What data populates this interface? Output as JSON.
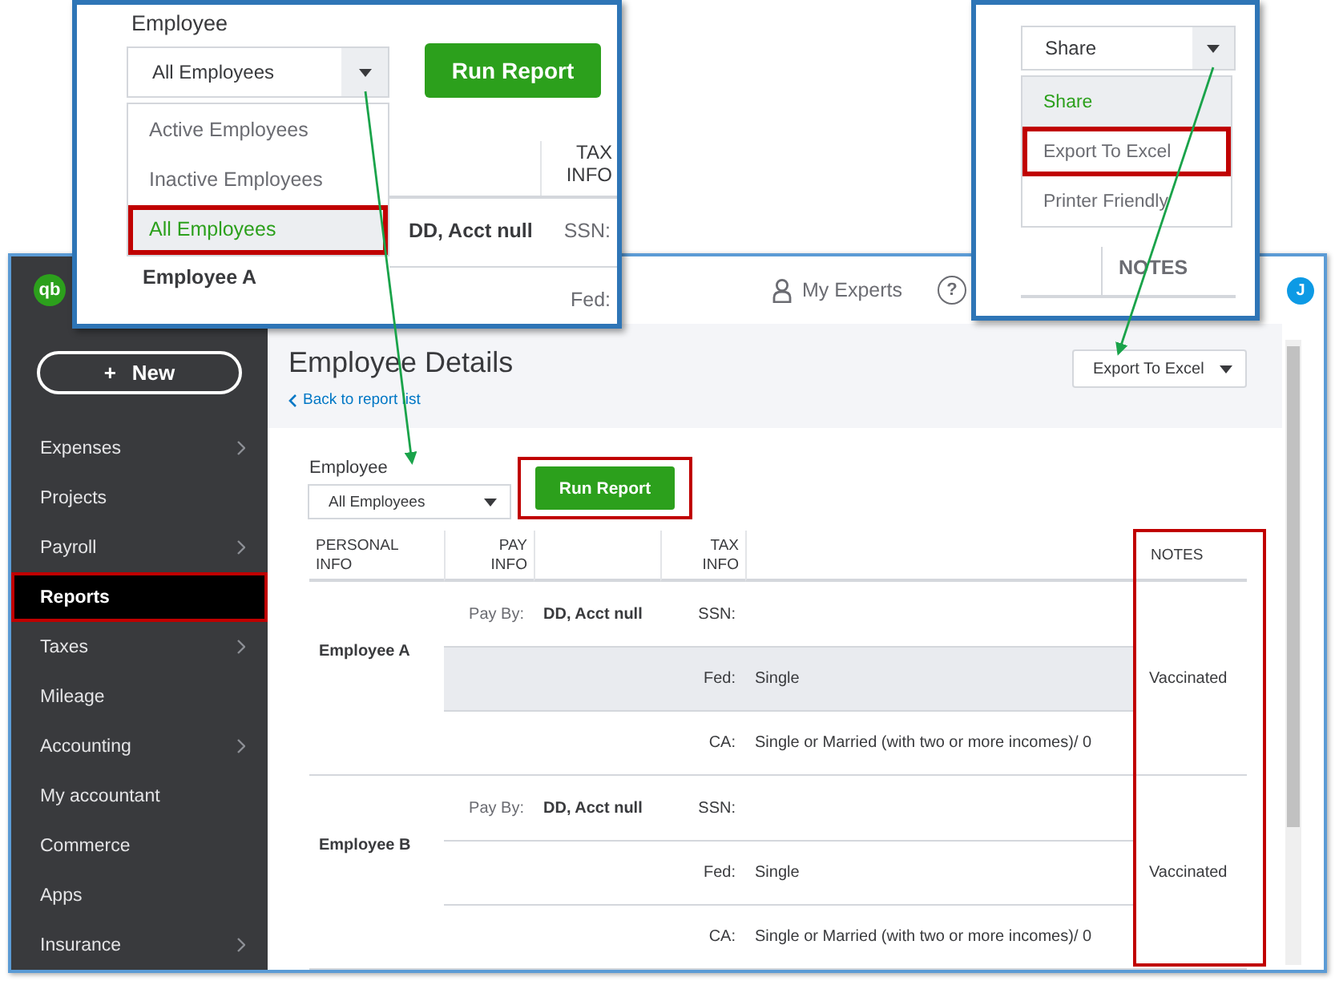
{
  "app": {
    "logo": "qb",
    "new_button": {
      "icon": "+",
      "label": "New"
    },
    "sidebar": {
      "items": [
        {
          "label": "Expenses",
          "arrow": true,
          "selected": false,
          "outlined": false
        },
        {
          "label": "Projects",
          "arrow": false,
          "selected": false,
          "outlined": false
        },
        {
          "label": "Payroll",
          "arrow": true,
          "selected": false,
          "outlined": false
        },
        {
          "label": "Reports",
          "arrow": false,
          "selected": true,
          "outlined": true
        },
        {
          "label": "Taxes",
          "arrow": true,
          "selected": false,
          "outlined": false
        },
        {
          "label": "Mileage",
          "arrow": false,
          "selected": false,
          "outlined": false
        },
        {
          "label": "Accounting",
          "arrow": true,
          "selected": false,
          "outlined": false
        },
        {
          "label": "My accountant",
          "arrow": false,
          "selected": false,
          "outlined": false
        },
        {
          "label": "Commerce",
          "arrow": false,
          "selected": false,
          "outlined": false
        },
        {
          "label": "Apps",
          "arrow": false,
          "selected": false,
          "outlined": false
        },
        {
          "label": "Insurance",
          "arrow": true,
          "selected": false,
          "outlined": false
        }
      ]
    },
    "topbar": {
      "experts": "My Experts",
      "help": "?",
      "avatar": "J"
    },
    "header": {
      "title": "Employee Details",
      "back_link": "Back to report list",
      "export_button": "Export To Excel"
    },
    "filter": {
      "label": "Employee",
      "select_value": "All Employees",
      "run_button": "Run Report",
      "run_outlined": true
    },
    "table": {
      "headers": {
        "personal_info": "PERSONAL INFO",
        "pay_info": "PAY INFO",
        "tax_info": "TAX INFO",
        "notes": "NOTES"
      },
      "notes_outlined": true,
      "rows": [
        {
          "employee": "Employee A",
          "pay_label": "Pay By:",
          "pay_value": "DD, Acct null",
          "notes": "Vaccinated",
          "tax_lines": [
            {
              "label": "SSN:",
              "highlighted": false
            },
            {
              "label": "Fed:",
              "value": "Single",
              "highlighted": true
            },
            {
              "label": "CA:",
              "value": "Single or Married (with two or more incomes)/ 0",
              "highlighted": false
            }
          ]
        },
        {
          "employee": "Employee B",
          "pay_label": "Pay By:",
          "pay_value": "DD, Acct null",
          "notes": "Vaccinated",
          "tax_lines": [
            {
              "label": "SSN:",
              "highlighted": false
            },
            {
              "label": "Fed:",
              "value": "Single",
              "highlighted": false
            },
            {
              "label": "CA:",
              "value": "Single or Married (with two or more incomes)/ 0",
              "highlighted": false
            }
          ]
        }
      ]
    }
  },
  "employee_callout": {
    "label": "Employee",
    "select_value": "All Employees",
    "run_button": "Run Report",
    "options": [
      {
        "label": "Active Employees",
        "selected": false,
        "outlined": false
      },
      {
        "label": "Inactive Employees",
        "selected": false,
        "outlined": false
      },
      {
        "label": "All Employees",
        "selected": true,
        "outlined": true
      }
    ],
    "tax_header": "TAX INFO",
    "pay_value": "DD, Acct null",
    "tax_label": "SSN:",
    "employee": "Employee A",
    "tax_label_2": "Fed:"
  },
  "share_callout": {
    "select_value": "Share",
    "options": [
      {
        "label": "Share",
        "selected": true,
        "outlined": false
      },
      {
        "label": "Export To Excel",
        "selected": false,
        "outlined": true
      },
      {
        "label": "Printer Friendly",
        "selected": false,
        "outlined": false
      }
    ],
    "notes_header": "NOTES"
  }
}
